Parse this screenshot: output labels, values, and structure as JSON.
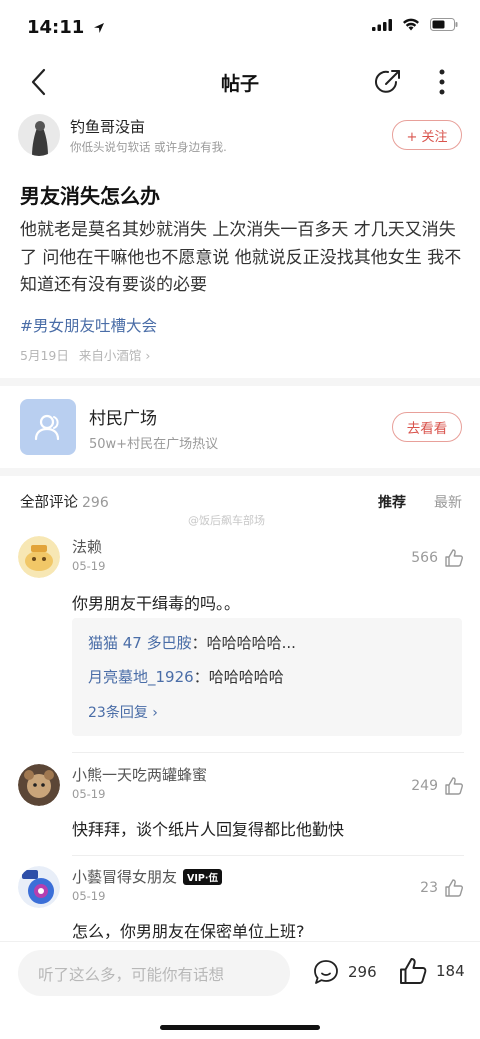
{
  "status_bar": {
    "time": "14:11"
  },
  "nav": {
    "title": "帖子"
  },
  "author": {
    "name": "钓鱼哥没亩",
    "signature": "你低头说句软话 或许身边有我.",
    "follow_label": "+ 关注"
  },
  "post": {
    "title": "男友消失怎么办",
    "body": "他就老是莫名其妙就消失 上次消失一百多天 才几天又消失了 问他在干嘛他也不愿意说 他就说反正没找其他女生 我不知道还有没有要谈的必要",
    "tag": "#男女朋友吐槽大会",
    "date": "5月19日",
    "source": "来自小酒馆 ›"
  },
  "village": {
    "name": "村民广场",
    "subtitle": "50w+村民在广场热议",
    "button_label": "去看看"
  },
  "comments_header": {
    "label": "全部评论",
    "count": "296",
    "sort_hot": "推荐",
    "sort_new": "最新"
  },
  "watermark": "@饭后飙车部场",
  "comments": [
    {
      "name": "法赖",
      "date": "05-19",
      "likes": "566",
      "text": "你男朋友干缉毒的吗。。",
      "replies": [
        {
          "user": "猫猫 47 多巴胺",
          "sep": "：",
          "text": "哈哈哈哈哈..."
        },
        {
          "user": "月亮墓地_1926",
          "sep": "：",
          "text": "哈哈哈哈哈"
        }
      ],
      "more_replies": "23条回复 ›"
    },
    {
      "name": "小熊一天吃两罐蜂蜜",
      "date": "05-19",
      "likes": "249",
      "text": "快拜拜，谈个纸片人回复得都比他勤快"
    },
    {
      "name": "小藝冒得女朋友",
      "badge": "VIP·伍",
      "date": "05-19",
      "likes": "23",
      "text": "怎么，你男朋友在保密单位上班?"
    }
  ],
  "bottom_bar": {
    "placeholder": "听了这么多，可能你有话想",
    "comment_count": "296",
    "like_count": "184"
  },
  "colors": {
    "accent_red": "#d9544d",
    "link_blue": "#4a6da7"
  }
}
